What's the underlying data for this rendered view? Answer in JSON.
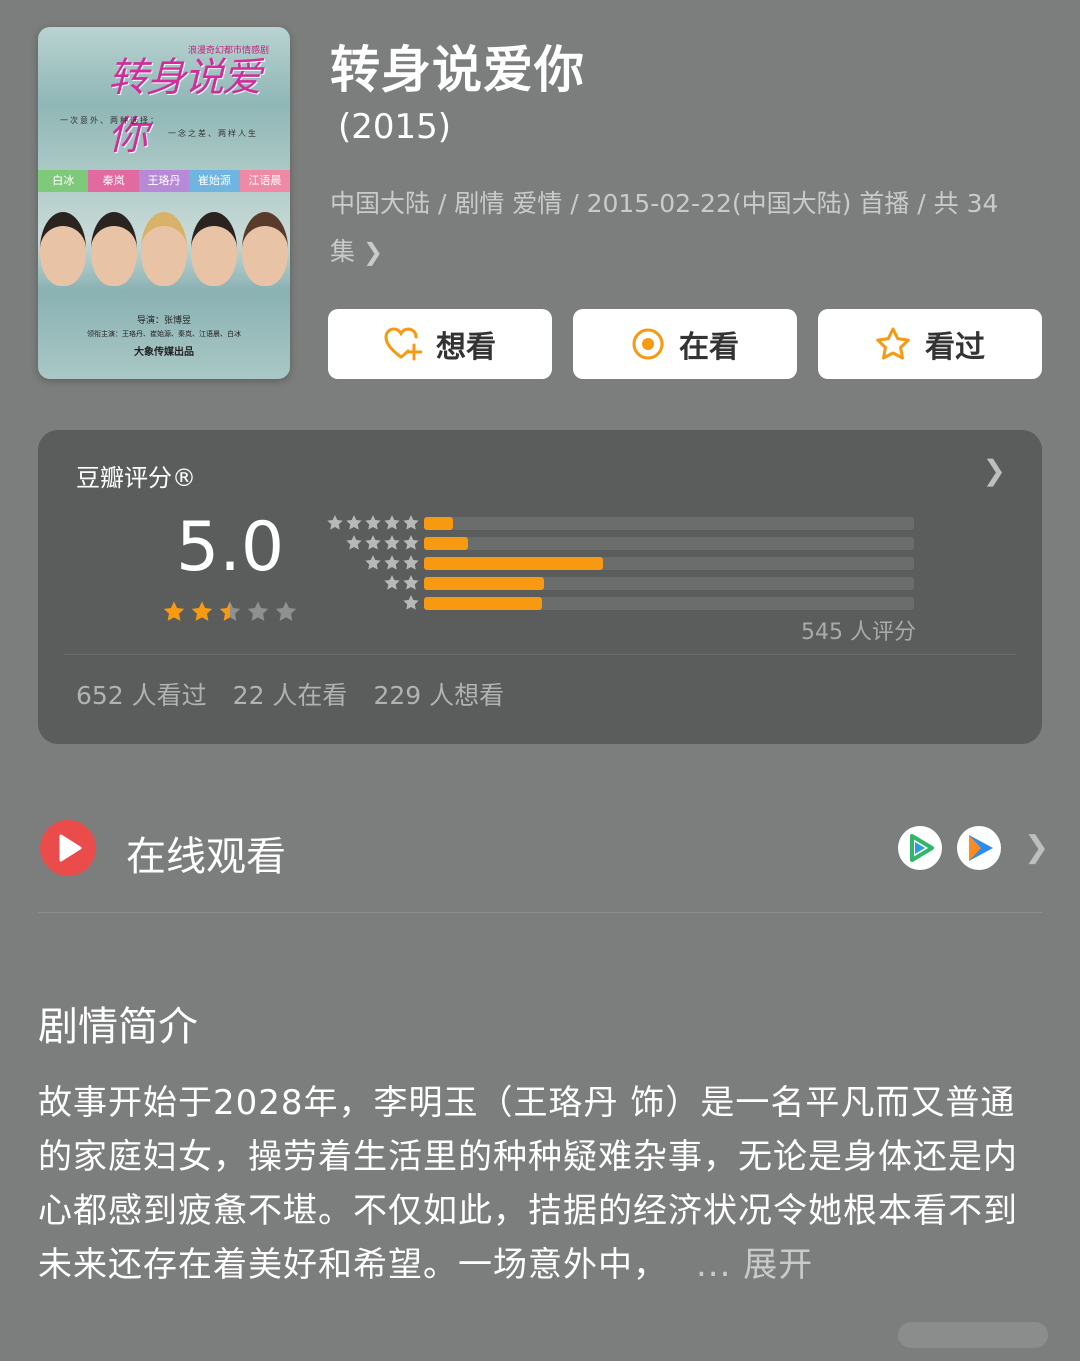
{
  "header": {
    "title": "转身说爱你",
    "year": "(2015)",
    "meta": "中国大陆 / 剧情 爱情 / 2015-02-22(中国大陆) 首播 / 共 34 集"
  },
  "poster": {
    "title": "转身说爱你",
    "tagline": "浪漫奇幻都市情感剧",
    "line1": "一次意外、两种选择；",
    "line2": "一念之差、两样人生",
    "cast": [
      "白冰",
      "秦岚",
      "王珞丹",
      "崔始源",
      "江语晨"
    ],
    "director": "导演：张博昱",
    "starring": "领衔主演：王珞丹、崔始源、秦岚、江语晨、白冰",
    "producer": "大象传媒出品"
  },
  "actions": {
    "want": "想看",
    "watching": "在看",
    "watched": "看过"
  },
  "rating": {
    "label": "豆瓣评分®",
    "score": "5.0",
    "stars": 2.5,
    "distribution": [
      {
        "stars": 5,
        "fraction": 0.06
      },
      {
        "stars": 4,
        "fraction": 0.09
      },
      {
        "stars": 3,
        "fraction": 0.365
      },
      {
        "stars": 2,
        "fraction": 0.245
      },
      {
        "stars": 1,
        "fraction": 0.24
      }
    ],
    "count": "545 人评分",
    "watched": "652 人看过",
    "watching": "22 人在看",
    "want": "229 人想看"
  },
  "online": {
    "title": "在线观看"
  },
  "synopsis": {
    "title": "剧情简介",
    "text": "故事开始于2028年，李明玉（王珞丹 饰）是一名平凡而又普通的家庭妇女，操劳着生活里的种种疑难杂事，无论是身体还是内心都感到疲惫不堪。不仅如此，拮据的经济状况令她根本看不到未来还存在着美好和希望。一场意外中，",
    "more": "... 展开"
  },
  "colors": {
    "background": "#7c7e7d",
    "card": "#5b5d5c",
    "accent": "#f79a12",
    "play": "#ea4b4b"
  }
}
